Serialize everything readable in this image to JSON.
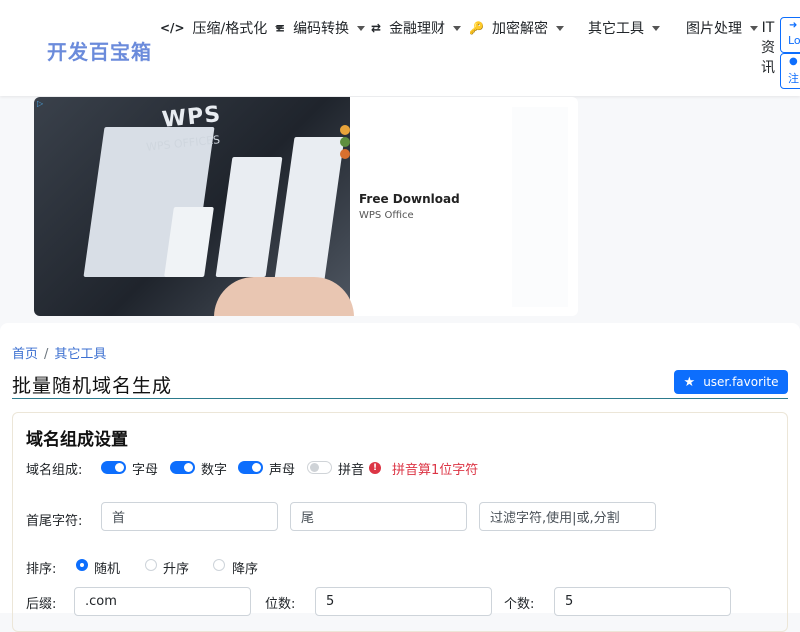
{
  "header": {
    "brand": "开发百宝箱",
    "nav": [
      {
        "icon": "</>",
        "label": "压缩/格式化"
      },
      {
        "icon": "≡",
        "label": "编码转换"
      },
      {
        "icon": "⇄",
        "label": "金融理财"
      },
      {
        "icon": "🔑",
        "label": "加密解密"
      },
      {
        "icon": "",
        "label": "其它工具"
      },
      {
        "icon": "",
        "label": "图片处理"
      }
    ],
    "it_chars": [
      "IT",
      "资",
      "讯"
    ],
    "login_label": "Lo",
    "register_label": "注"
  },
  "ad": {
    "mark": "▷",
    "image_brand": "WPS",
    "image_sub": "WPS OFFICES",
    "title": "Free Download",
    "description": "WPS Office"
  },
  "breadcrumb": {
    "home": "首页",
    "separator": "/",
    "current": "其它工具"
  },
  "page": {
    "title": "批量随机域名生成",
    "favorite_label": "user.favorite"
  },
  "settings": {
    "title": "域名组成设置",
    "composition_label": "域名组成:",
    "options": [
      {
        "label": "字母",
        "checked": true
      },
      {
        "label": "数字",
        "checked": true
      },
      {
        "label": "声母",
        "checked": true
      },
      {
        "label": "拼音",
        "checked": false
      }
    ],
    "pinyin_note": "拼音算1位字符",
    "head_tail_label": "首尾字符:",
    "head_placeholder": "首",
    "tail_placeholder": "尾",
    "filter_placeholder": "过滤字符,使用|或,分割",
    "sort_label": "排序:",
    "sort_options": [
      {
        "label": "随机",
        "selected": true
      },
      {
        "label": "升序",
        "selected": false
      },
      {
        "label": "降序",
        "selected": false
      }
    ],
    "suffix_label": "后缀:",
    "suffix_value": ".com",
    "digits_label": "位数:",
    "digits_value": "5",
    "count_label": "个数:",
    "count_value": "5"
  },
  "colors": {
    "primary": "#0d6efd",
    "brand": "#6b8bdb",
    "danger": "#dc3545"
  }
}
